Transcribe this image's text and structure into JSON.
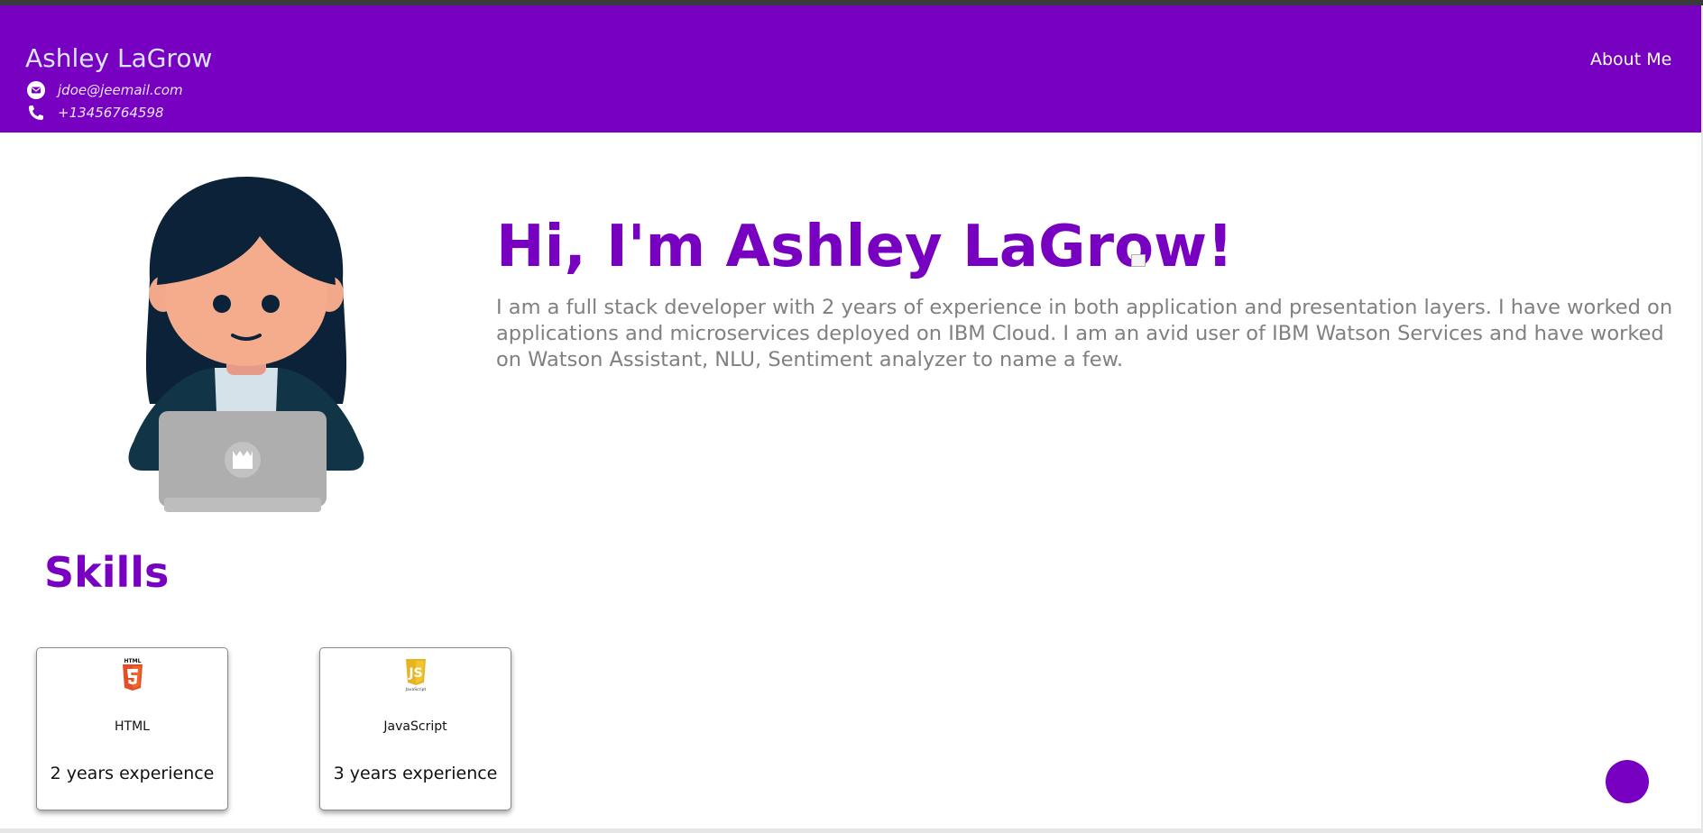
{
  "colors": {
    "brand": "#7800c0",
    "header_name": "#d9e4ff",
    "body_text": "#808080"
  },
  "header": {
    "name": "Ashley LaGrow",
    "email": "jdoe@jeemail.com",
    "phone": "+13456764598",
    "email_icon": "envelope-icon",
    "phone_icon": "phone-icon",
    "nav": [
      {
        "label": "About Me"
      }
    ]
  },
  "hero": {
    "avatar_icon": "developer-avatar-illustration",
    "title": "Hi, I'm Ashley LaGrow!",
    "intro": "I am a full stack developer with 2 years of experience in both application and presentation layers. I have worked on applications and microservices deployed on IBM Cloud. I am an avid user of IBM Watson Services and have worked on Watson Assistant, NLU, Sentiment analyzer to name a few."
  },
  "skills": {
    "title": "Skills",
    "items": [
      {
        "name": "HTML",
        "experience": "2 years experience",
        "icon": "html5-logo"
      },
      {
        "name": "JavaScript",
        "experience": "3 years experience",
        "icon": "javascript-logo"
      }
    ]
  },
  "chat_button": {
    "icon": "chat-launcher-icon"
  }
}
